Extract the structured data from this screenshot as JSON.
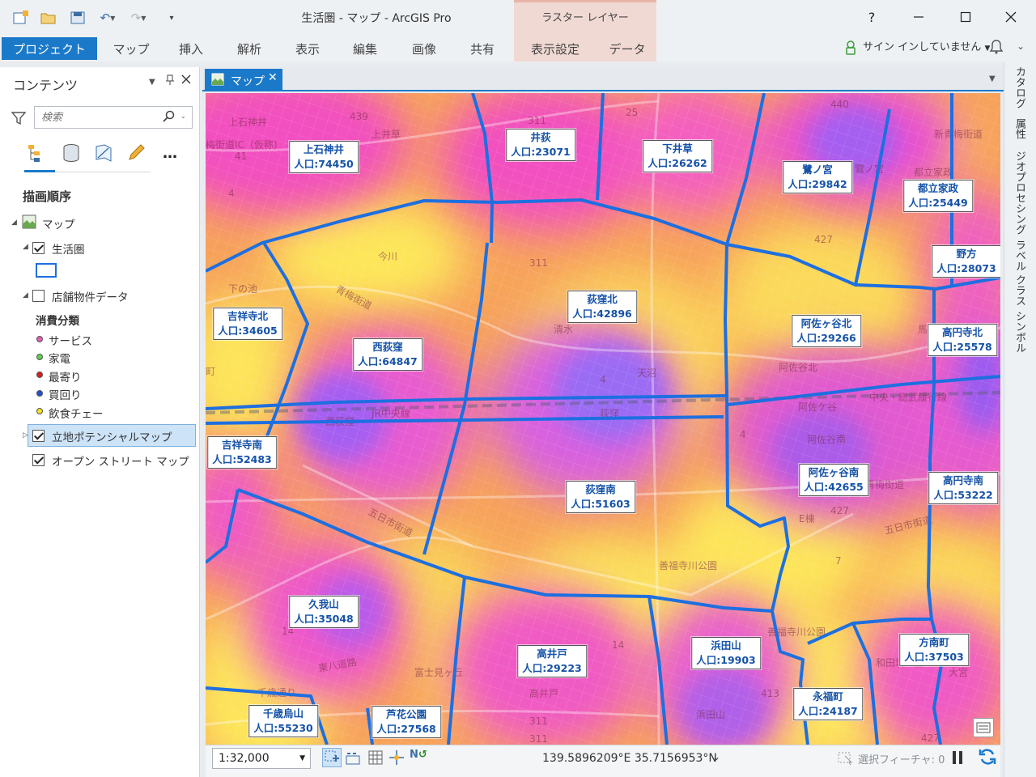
{
  "window": {
    "title": "生活圏 - マップ - ArcGIS Pro",
    "context_header": "ラスター レイヤー",
    "help": "?"
  },
  "ribbon": {
    "project_tab": "プロジェクト",
    "tabs": [
      "マップ",
      "挿入",
      "解析",
      "表示",
      "編集",
      "画像",
      "共有"
    ],
    "context_tabs": [
      "表示設定",
      "データ"
    ],
    "signin": "サイン インしていません"
  },
  "contents": {
    "title": "コンテンツ",
    "search_placeholder": "検索",
    "draw_order": "描画順序",
    "tree": {
      "map": "マップ",
      "layer_seikatsuken": "生活圏",
      "layer_store": "店舗物件データ",
      "category_header": "消費分類",
      "categories": [
        {
          "label": "サービス",
          "color": "#e85bb5"
        },
        {
          "label": "家電",
          "color": "#5bd14a"
        },
        {
          "label": "最寄り",
          "color": "#d62020"
        },
        {
          "label": "買回り",
          "color": "#1f4fd8"
        },
        {
          "label": "飲食チェー",
          "color": "#f2e21f"
        }
      ],
      "layer_potential": "立地ポテンシャルマップ",
      "layer_osm": "オープン ストリート マップ"
    }
  },
  "map_view": {
    "tab_label": "マップ",
    "labels": [
      {
        "name": "上石神井",
        "pop": "人口:74450"
      },
      {
        "name": "井荻",
        "pop": "人口:23071"
      },
      {
        "name": "下井草",
        "pop": "人口:26262"
      },
      {
        "name": "鷺ノ宮",
        "pop": "人口:29842"
      },
      {
        "name": "都立家政",
        "pop": "人口:25449"
      },
      {
        "name": "野方",
        "pop": "人口:28073"
      },
      {
        "name": "吉祥寺北",
        "pop": "人口:34605"
      },
      {
        "name": "荻窪北",
        "pop": "人口:42896"
      },
      {
        "name": "西荻窪",
        "pop": "人口:64847"
      },
      {
        "name": "阿佐ヶ谷北",
        "pop": "人口:29266"
      },
      {
        "name": "高円寺北",
        "pop": "人口:25578"
      },
      {
        "name": "吉祥寺南",
        "pop": "人口:52483"
      },
      {
        "name": "荻窪南",
        "pop": "人口:51603"
      },
      {
        "name": "阿佐ヶ谷南",
        "pop": "人口:42655"
      },
      {
        "name": "高円寺南",
        "pop": "人口:53222"
      },
      {
        "name": "久我山",
        "pop": "人口:35048"
      },
      {
        "name": "高井戸",
        "pop": "人口:29223"
      },
      {
        "name": "浜田山",
        "pop": "人口:19903"
      },
      {
        "name": "方南町",
        "pop": "人口:37503"
      },
      {
        "name": "永福町",
        "pop": "人口:24187"
      },
      {
        "name": "千歳烏山",
        "pop": "人口:55230"
      },
      {
        "name": "芦花公園",
        "pop": "人口:27568"
      }
    ],
    "basemap_text": [
      {
        "t": "上石神井"
      },
      {
        "t": "439"
      },
      {
        "t": "上井草"
      },
      {
        "t": "311"
      },
      {
        "t": "25"
      },
      {
        "t": "440"
      },
      {
        "t": "新青梅街道"
      },
      {
        "t": "鷺ノ宮"
      },
      {
        "t": "都立家政"
      },
      {
        "t": "427"
      },
      {
        "t": "今川"
      },
      {
        "t": "311"
      },
      {
        "t": "青梅街道"
      },
      {
        "t": "清水"
      },
      {
        "t": "天沼"
      },
      {
        "t": "荻窪"
      },
      {
        "t": "阿佐谷北"
      },
      {
        "t": "阿佐ケ谷"
      },
      {
        "t": "阿佐谷南"
      },
      {
        "t": "西荻窪"
      },
      {
        "t": "JR中央線"
      },
      {
        "t": "馬橋"
      },
      {
        "t": "中央・総武緩行線"
      },
      {
        "t": "五日市街道"
      },
      {
        "t": "青梅街道"
      },
      {
        "t": "427"
      },
      {
        "t": "五日市街道"
      },
      {
        "t": "善福寺川公園"
      },
      {
        "t": "E棟"
      },
      {
        "t": "7"
      },
      {
        "t": "善福寺川公園"
      },
      {
        "t": "14"
      },
      {
        "t": "14"
      },
      {
        "t": "富士見ヶ丘"
      },
      {
        "t": "高井戸"
      },
      {
        "t": "東八道路"
      },
      {
        "t": "千歳通り"
      },
      {
        "t": "311"
      },
      {
        "t": "311"
      },
      {
        "t": "浜田山"
      },
      {
        "t": "413"
      },
      {
        "t": "和田堀公園"
      },
      {
        "t": "大宮"
      },
      {
        "t": "427"
      },
      {
        "t": "4"
      },
      {
        "t": "4"
      },
      {
        "t": "4"
      },
      {
        "t": "梅街道IC（仮称）"
      },
      {
        "t": "41"
      },
      {
        "t": "下の池"
      },
      {
        "t": "町"
      }
    ]
  },
  "statusbar": {
    "scale": "1:32,000",
    "coordinates": "139.5896209°E 35.7156953°N",
    "selected_features": "選択フィーチャ: 0"
  },
  "right_dock": [
    "カタログ",
    "属性",
    "ジオプロセシング",
    "ラベル クラス",
    "シンボル"
  ],
  "colors": {
    "accent": "#1b79c9",
    "boundary": "#1e6fe0",
    "label_text": "#1552a8"
  }
}
